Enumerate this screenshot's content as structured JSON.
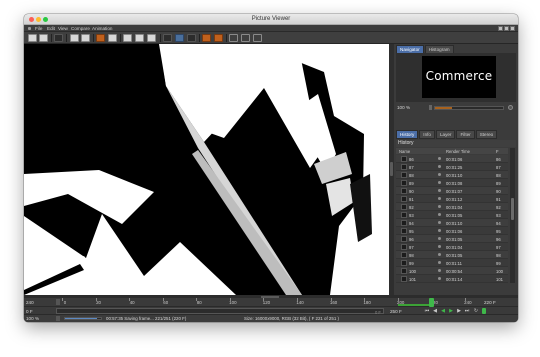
{
  "window": {
    "title": "Picture Viewer",
    "menu": [
      "File",
      "Edit",
      "View",
      "Compare",
      "Animation"
    ]
  },
  "navigator": {
    "tabs": [
      "Navigator",
      "Histogram"
    ],
    "thumbnail_text": "Commerce",
    "zoom": "100 %",
    "zoom_level": 0.25
  },
  "history": {
    "tabs": [
      "History",
      "Info",
      "Layer",
      "Filter",
      "Stereo"
    ],
    "title": "History",
    "columns": {
      "name": "Name",
      "render_time": "Render Time",
      "frame": "F"
    },
    "rows": [
      {
        "name": "86",
        "time": "00:01:06",
        "frame": "86"
      },
      {
        "name": "87",
        "time": "00:01:25",
        "frame": "87"
      },
      {
        "name": "88",
        "time": "00:01:10",
        "frame": "88"
      },
      {
        "name": "89",
        "time": "00:01:08",
        "frame": "89"
      },
      {
        "name": "90",
        "time": "00:01:07",
        "frame": "90"
      },
      {
        "name": "91",
        "time": "00:01:12",
        "frame": "91"
      },
      {
        "name": "92",
        "time": "00:01:04",
        "frame": "92"
      },
      {
        "name": "93",
        "time": "00:01:05",
        "frame": "93"
      },
      {
        "name": "94",
        "time": "00:01:10",
        "frame": "94"
      },
      {
        "name": "95",
        "time": "00:01:06",
        "frame": "95"
      },
      {
        "name": "96",
        "time": "00:01:05",
        "frame": "96"
      },
      {
        "name": "97",
        "time": "00:01:04",
        "frame": "97"
      },
      {
        "name": "98",
        "time": "00:01:05",
        "frame": "98"
      },
      {
        "name": "99",
        "time": "00:01:11",
        "frame": "99"
      },
      {
        "name": "100",
        "time": "00:00:54",
        "frame": "100"
      },
      {
        "name": "101",
        "time": "00:01:14",
        "frame": "101"
      }
    ]
  },
  "timeline": {
    "start": "240",
    "ticks": [
      "0",
      "20",
      "40",
      "60",
      "80",
      "100",
      "120",
      "140",
      "160",
      "180",
      "200",
      "220",
      "240"
    ],
    "end": "220 F",
    "current_frame": 220,
    "max_frame": 252
  },
  "transport": {
    "left_value": "0 F",
    "range_text": "0 F",
    "right_value": "250 F"
  },
  "status": {
    "zoom": "100 %",
    "message": "00:57:35 Saving frame... 221/251 (220 F)",
    "info": "Size: 16000x9000, RGB (32 Bit), ( F 221 of 251 )",
    "progress": 0.88
  },
  "colors": {
    "accent": "#4b6ea7",
    "progress_orange": "#a8621e",
    "timeline_green": "#3ca236"
  }
}
